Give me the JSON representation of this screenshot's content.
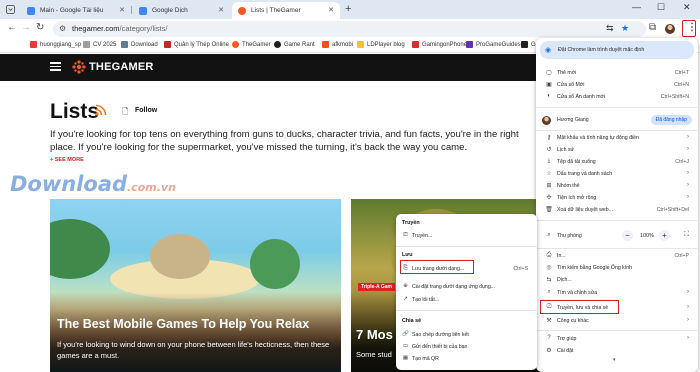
{
  "tabs": [
    {
      "label": "Main - Google Tài liệu",
      "color": "#4285f4"
    },
    {
      "label": "Google Dịch",
      "color": "#4285f4"
    },
    {
      "label": "Lists | TheGamer",
      "color": "#ff5722",
      "active": true
    }
  ],
  "toolbar": {
    "url_host": "thegamer.com",
    "url_path": "/category/lists/"
  },
  "bookmarks": [
    {
      "label": "huonggiang_sp",
      "color": "#e53935"
    },
    {
      "label": "CV 2025",
      "color": "#9e9e9e"
    },
    {
      "label": "Download",
      "color": "#607d8b"
    },
    {
      "label": "Quản lý Thép Online",
      "color": "#c62828"
    },
    {
      "label": "TheGamer",
      "color": "#ff5722"
    },
    {
      "label": "Game Rant",
      "color": "#212121"
    },
    {
      "label": "afkmobi",
      "color": "#f4511e"
    },
    {
      "label": "LDPlayer blog",
      "color": "#fbc02d"
    },
    {
      "label": "GamingonPhone",
      "color": "#d32f2f"
    },
    {
      "label": "ProGameGuides",
      "color": "#5e35b1"
    },
    {
      "label": "G",
      "color": "#212121"
    }
  ],
  "site": {
    "logo": "THEGAMER",
    "page_title": "Lists",
    "follow": "Follow",
    "intro": "If you're looking for top tens on everything from guns to ducks, character trivia, and fun facts, you're in the right place. If you're looking for the supermarket, you've missed the turning, it's back the way you came.",
    "see_more": "+ SEE MORE"
  },
  "watermark": {
    "main": "Download",
    "suffix": ".com.vn"
  },
  "cards": [
    {
      "title": "The Best Mobile Games To Help You Relax",
      "desc": "If you're looking to wind down on your phone between life's hecticness, then these games are a must."
    },
    {
      "title": "7 Mos",
      "desc": "Some stud",
      "tag": "Triple-A Gam"
    }
  ],
  "menu": {
    "banner": "Đặt Chrome làm trình duyệt mặc định",
    "items": [
      {
        "label": "Thẻ mới",
        "shortcut": "Ctrl+T",
        "icon": "new-tab-icon"
      },
      {
        "label": "Cửa sổ Mới",
        "shortcut": "Ctrl+N",
        "icon": "new-window-icon"
      },
      {
        "label": "Cửa sổ Ẩn danh mới",
        "shortcut": "Ctrl+Shift+N",
        "icon": "incognito-icon"
      }
    ],
    "profile": {
      "name": "Hương Giang",
      "status": "Đã đăng nhập"
    },
    "items2": [
      {
        "label": "Mật khẩu và tính năng tự động điền",
        "icon": "key-icon"
      },
      {
        "label": "Lịch sử",
        "icon": "history-icon"
      },
      {
        "label": "Tệp đã tải xuống",
        "shortcut": "Ctrl+J",
        "icon": "download-icon"
      },
      {
        "label": "Dấu trang và danh sách",
        "icon": "star-icon"
      },
      {
        "label": "Nhóm thẻ",
        "icon": "tab-groups-icon"
      },
      {
        "label": "Tiện ích mở rộng",
        "icon": "extensions-icon"
      },
      {
        "label": "Xoá dữ liệu duyệt web...",
        "shortcut": "Ctrl+Shift+Del",
        "icon": "trash-icon"
      }
    ],
    "zoom": {
      "label": "Thu phóng",
      "value": "100%"
    },
    "items3": [
      {
        "label": "In...",
        "shortcut": "Ctrl+P",
        "icon": "print-icon"
      },
      {
        "label": "Tìm kiếm bằng Google Ống kính",
        "icon": "lens-icon"
      },
      {
        "label": "Dịch...",
        "icon": "translate-icon"
      },
      {
        "label": "Tìm và chỉnh sửa",
        "icon": "find-icon"
      },
      {
        "label": "Truyền, lưu và chia sẻ",
        "icon": "cast-icon"
      },
      {
        "label": "Công cụ khác",
        "icon": "tools-icon"
      }
    ],
    "items4": [
      {
        "label": "Trợ giúp",
        "icon": "help-icon"
      },
      {
        "label": "Cài đặt",
        "icon": "settings-icon"
      }
    ]
  },
  "submenu": {
    "sections": [
      {
        "header": "Truyền",
        "items": [
          {
            "label": "Truyền...",
            "icon": "cast-icon"
          }
        ]
      },
      {
        "header": "Lưu",
        "items": [
          {
            "label": "Lưu trang dưới dạng...",
            "shortcut": "Ctrl+S",
            "icon": "save-page-icon"
          },
          {
            "label": "Cài đặt trang dưới dạng ứng dụng...",
            "icon": "install-app-icon"
          },
          {
            "label": "Tạo lối tắt...",
            "icon": "shortcut-icon"
          }
        ]
      },
      {
        "header": "Chia sẻ",
        "items": [
          {
            "label": "Sao chép đường liên kết",
            "icon": "link-icon"
          },
          {
            "label": "Gửi đến thiết bị của bạn",
            "icon": "devices-icon"
          },
          {
            "label": "Tạo mã QR",
            "icon": "qr-icon"
          }
        ]
      }
    ]
  }
}
